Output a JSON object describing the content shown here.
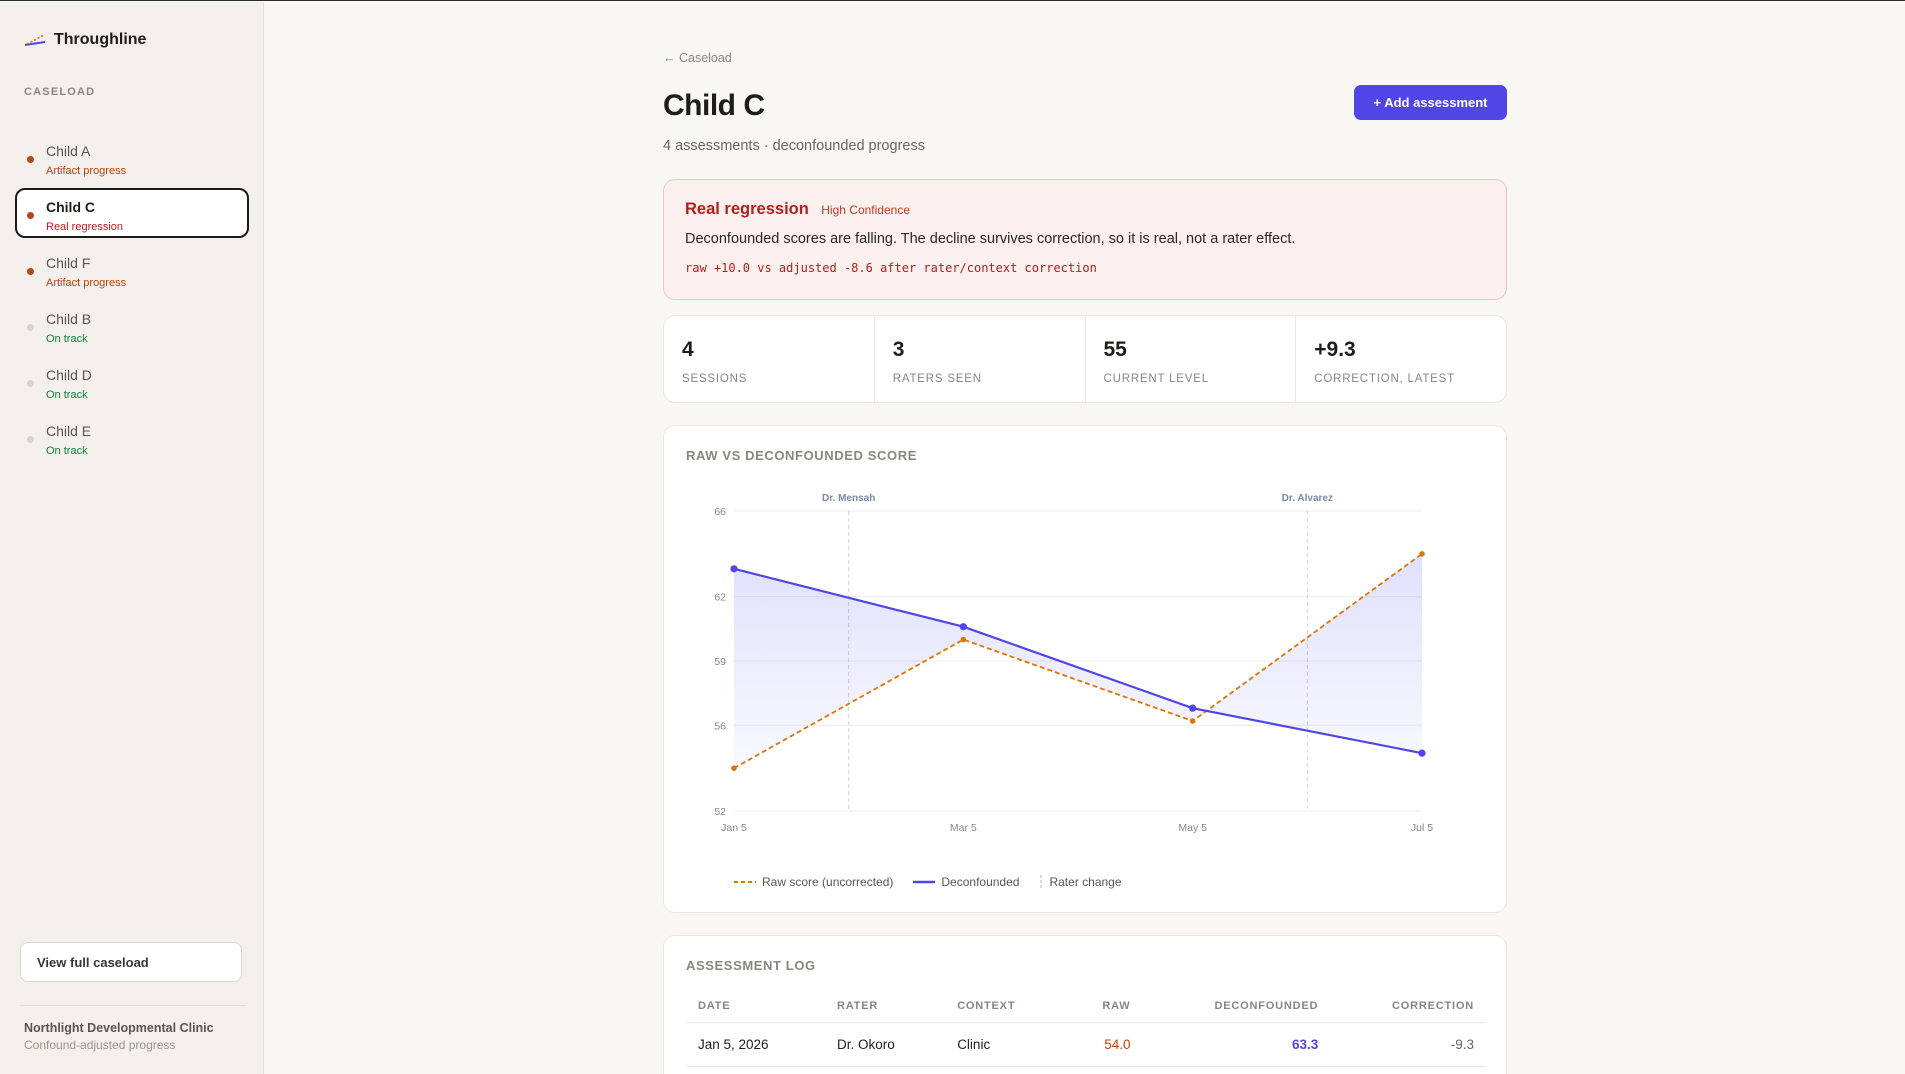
{
  "app": {
    "name": "Throughline"
  },
  "sidebar": {
    "section_label": "CASELOAD",
    "items": [
      {
        "name": "Child A",
        "status": "Artifact progress",
        "status_color": "#c2410c",
        "dot_color": "#b5461a",
        "active": false
      },
      {
        "name": "Child C",
        "status": "Real regression",
        "status_color": "#b91c1c",
        "dot_color": "#b5461a",
        "active": true
      },
      {
        "name": "Child F",
        "status": "Artifact progress",
        "status_color": "#c2410c",
        "dot_color": "#b5461a",
        "active": false
      },
      {
        "name": "Child B",
        "status": "On track",
        "status_color": "#15803d",
        "dot_color": "#d8d2c8",
        "active": false
      },
      {
        "name": "Child D",
        "status": "On track",
        "status_color": "#15803d",
        "dot_color": "#d8d2c8",
        "active": false
      },
      {
        "name": "Child E",
        "status": "On track",
        "status_color": "#15803d",
        "dot_color": "#d8d2c8",
        "active": false
      }
    ],
    "view_all_label": "View full caseload",
    "clinic_name": "Northlight Developmental Clinic",
    "clinic_sub": "Confound-adjusted progress"
  },
  "main": {
    "breadcrumb": "← Caseload",
    "title": "Child C",
    "subtitle": "4 assessments · deconfounded progress",
    "add_button": "+ Add assessment",
    "alert": {
      "title": "Real regression",
      "confidence": "High Confidence",
      "body": "Deconfounded scores are falling. The decline survives correction, so it is real, not a rater effect.",
      "mono": "raw +10.0 vs adjusted -8.6 after rater/context correction"
    },
    "stats": [
      {
        "value": "4",
        "label": "SESSIONS"
      },
      {
        "value": "3",
        "label": "RATERS SEEN"
      },
      {
        "value": "55",
        "label": "CURRENT LEVEL"
      },
      {
        "value": "+9.3",
        "label": "CORRECTION, LATEST"
      }
    ],
    "chart_title": "RAW VS DECONFOUNDED SCORE",
    "log_title": "ASSESSMENT LOG",
    "log_columns": [
      "DATE",
      "RATER",
      "CONTEXT",
      "RAW",
      "DECONFOUNDED",
      "CORRECTION"
    ],
    "log_rows": [
      {
        "date": "Jan 5, 2026",
        "rater": "Dr. Okoro",
        "context": "Clinic",
        "raw": "54.0",
        "deconfounded": "63.3",
        "correction": "-9.3"
      }
    ]
  },
  "colors": {
    "accent": "#4f46e5",
    "raw": "#d97706",
    "regression": "#b0201e"
  },
  "chart_data": {
    "type": "line",
    "categories": [
      "Jan 5",
      "Mar 5",
      "May 5",
      "Jul 5"
    ],
    "series": [
      {
        "name": "Raw score (uncorrected)",
        "values": [
          54.0,
          60.0,
          56.2,
          64.0
        ],
        "style": "dashed",
        "color": "#d97706"
      },
      {
        "name": "Deconfounded",
        "values": [
          63.3,
          60.6,
          56.8,
          54.7
        ],
        "style": "solid",
        "color": "#4f46e5"
      }
    ],
    "yticks": [
      52,
      56,
      59,
      62,
      66
    ],
    "ylim": [
      52,
      66
    ],
    "rater_changes": [
      {
        "label": "Dr. Mensah",
        "x": 0.5
      },
      {
        "label": "Dr. Alvarez",
        "x": 2.5
      }
    ],
    "legend": [
      "Raw score (uncorrected)",
      "Deconfounded",
      "Rater change"
    ],
    "legend_placement": "bottom-left",
    "grid": true
  }
}
